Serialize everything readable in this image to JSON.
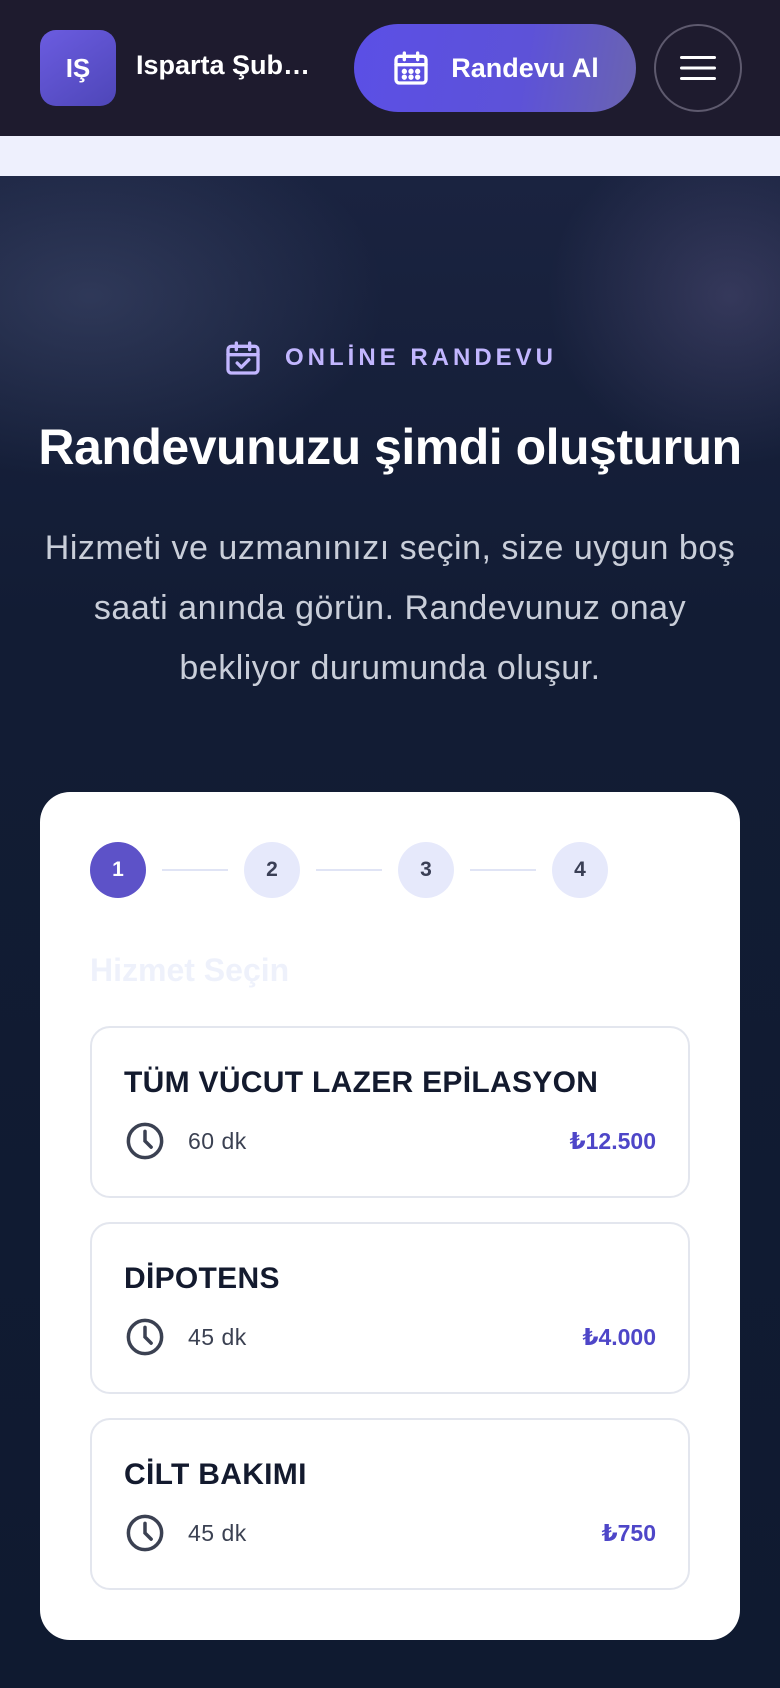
{
  "header": {
    "logo_initials": "IŞ",
    "brand": "Isparta Şubesi",
    "cta_label": "Randevu Al"
  },
  "hero": {
    "eyebrow": "ONLİNE RANDEVU",
    "title": "Randevunuzu şimdi oluşturun",
    "subtitle": "Hizmeti ve uzmanınızı seçin, size uygun boş saati anında görün. Randevunuz onay bekliyor durumunda oluşur."
  },
  "stepper": {
    "steps": [
      "1",
      "2",
      "3",
      "4"
    ],
    "active_step": 1
  },
  "booking": {
    "heading": "Hizmet Seçin",
    "services": [
      {
        "name": "TÜM VÜCUT LAZER EPİLASYON",
        "duration": "60 dk",
        "price": "₺12.500"
      },
      {
        "name": "DİPOTENS",
        "duration": "45 dk",
        "price": "₺4.000"
      },
      {
        "name": "CİLT BAKIMI",
        "duration": "45 dk",
        "price": "₺750"
      }
    ]
  },
  "colors": {
    "accent": "#5d52c8",
    "price": "#4e46c8",
    "header_bg": "#1e1b2e",
    "hero_bg": "#101a30"
  },
  "icons": {
    "cta": "calendar-icon",
    "menu": "hamburger-icon",
    "eyebrow": "calendar-check-icon",
    "duration": "clock-icon"
  }
}
